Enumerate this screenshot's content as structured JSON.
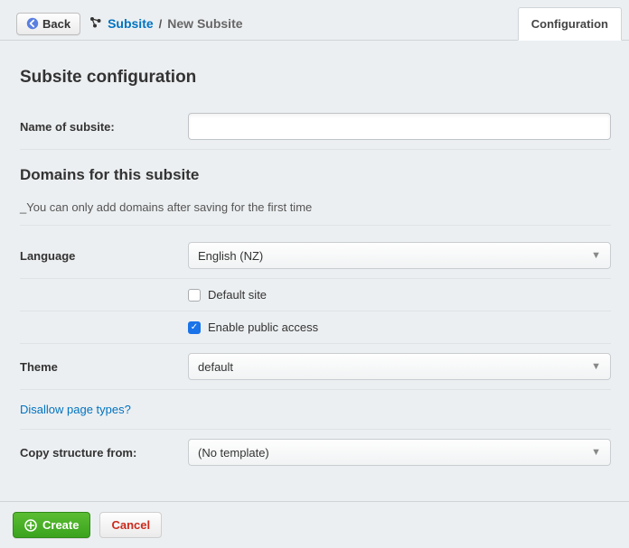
{
  "topbar": {
    "back_label": "Back",
    "breadcrumb_link": "Subsite",
    "breadcrumb_sep": "/",
    "breadcrumb_current": "New Subsite"
  },
  "tabs": {
    "configuration": "Configuration"
  },
  "sections": {
    "config_title": "Subsite configuration",
    "domains_title": "Domains for this subsite"
  },
  "fields": {
    "name_label": "Name of subsite:",
    "name_value": "",
    "domains_hint": "_You can only add domains after saving for the first time",
    "language_label": "Language",
    "language_value": "English (NZ)",
    "default_site_label": "Default site",
    "default_site_checked": false,
    "public_access_label": "Enable public access",
    "public_access_checked": true,
    "theme_label": "Theme",
    "theme_value": "default",
    "disallow_link": "Disallow page types?",
    "copy_label": "Copy structure from:",
    "copy_value": "(No template)"
  },
  "footer": {
    "create_label": "Create",
    "cancel_label": "Cancel"
  },
  "colors": {
    "link_blue": "#0073c1",
    "create_green": "#3aa31d",
    "cancel_red": "#cc2a1d"
  }
}
